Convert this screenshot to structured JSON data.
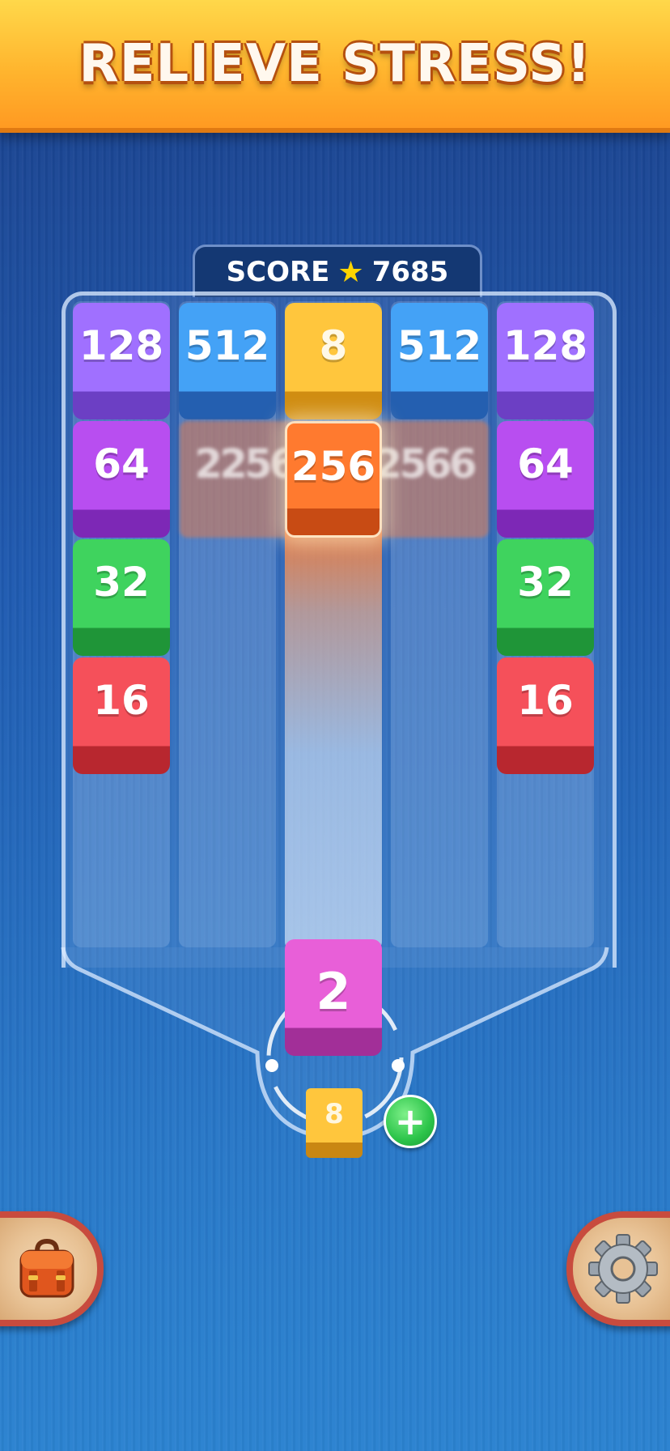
{
  "banner": {
    "title": "RELIEVE STRESS!"
  },
  "score": {
    "label": "SCORE",
    "value": "7685"
  },
  "board": {
    "rows": [
      [
        "128",
        "512",
        "8",
        "512",
        "128"
      ],
      [
        "64",
        "",
        "256",
        "",
        "64"
      ],
      [
        "32",
        "",
        "",
        "",
        "32"
      ],
      [
        "16",
        "",
        "",
        "",
        "16"
      ]
    ],
    "motion_ghosts": [
      "2256",
      "2566"
    ]
  },
  "shooter": {
    "current_tile": "2",
    "next_tile": "8",
    "add_label": "+"
  },
  "buttons": {
    "bag": "bag-icon",
    "settings": "gear-icon"
  },
  "colors": {
    "t128": "#a070ff",
    "t512": "#44a2f6",
    "t8": "#ffc63d",
    "t64": "#b84ef0",
    "t32": "#3fd35e",
    "t16": "#f5505a",
    "t256": "#ff7a2f",
    "t2": "#e85fd8"
  }
}
